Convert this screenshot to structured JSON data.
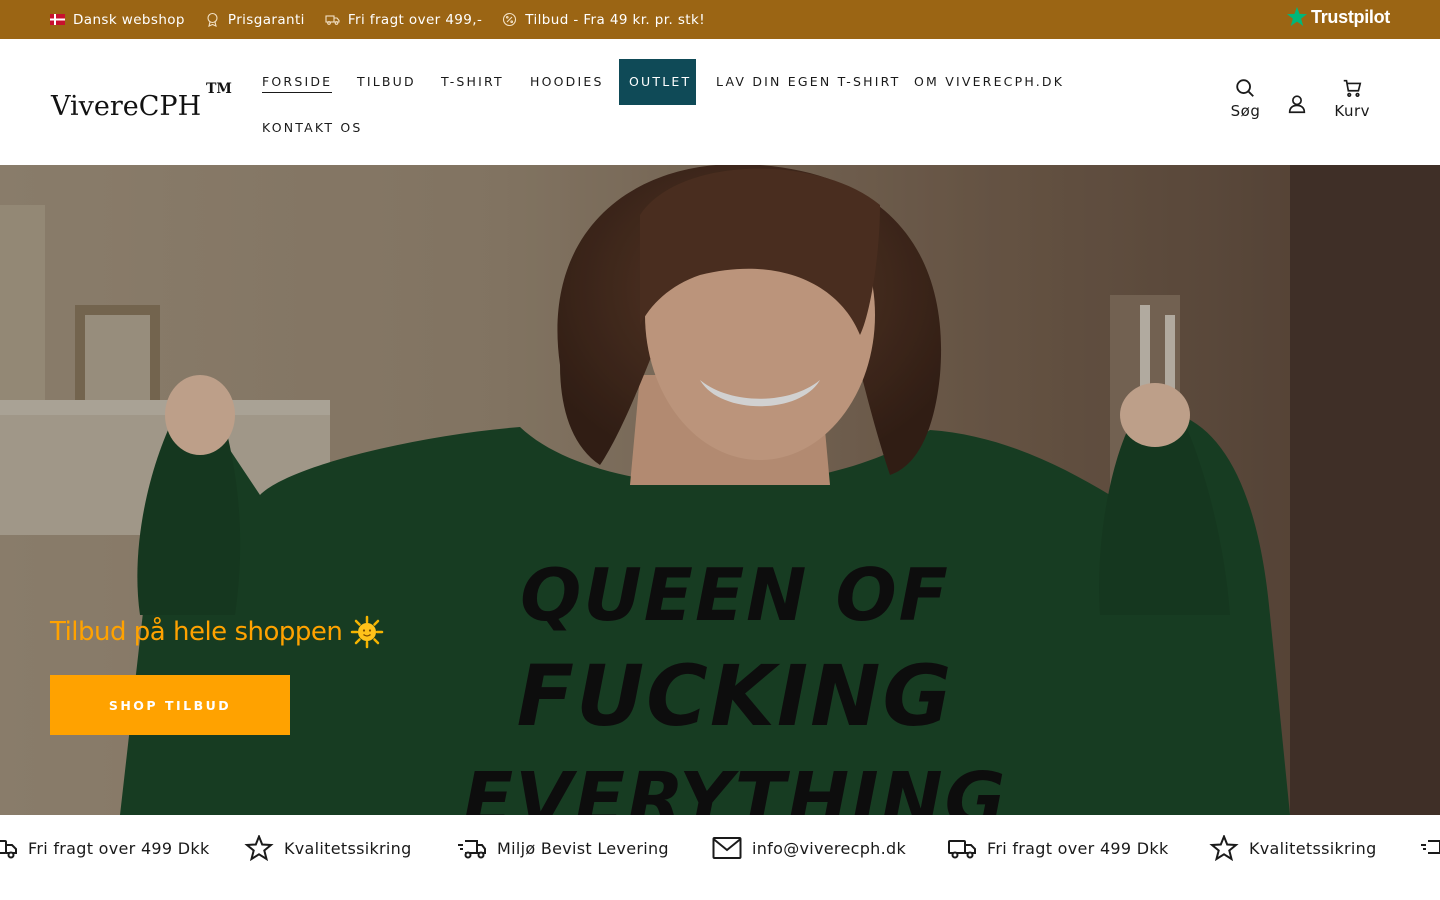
{
  "announcement": {
    "messages": [
      {
        "icon": "denmark-flag-icon",
        "text": "Dansk webshop"
      },
      {
        "icon": "award-icon",
        "text": "Prisgaranti"
      },
      {
        "icon": "truck-icon",
        "text": "Fri fragt over 499,-"
      },
      {
        "icon": "discount-icon",
        "text": "Tilbud - Fra 49 kr. pr. stk!"
      }
    ],
    "trustpilot_label": "Trustpilot",
    "background_color": "#9b6514"
  },
  "header": {
    "logo": "VivereCPH",
    "logo_mark": "TM",
    "nav": [
      {
        "label": "FORSIDE",
        "active": true
      },
      {
        "label": "TILBUD"
      },
      {
        "label": "T-SHIRT"
      },
      {
        "label": "HOODIES"
      },
      {
        "label": "OUTLET",
        "highlighted": true
      },
      {
        "label": "LAV DIN EGEN T-SHIRT"
      },
      {
        "label": "OM VIVERECPH.DK"
      },
      {
        "label": "KONTAKT OS"
      }
    ],
    "search_label": "Søg",
    "cart_label": "Kurv",
    "outlet_color": "#0f4a57"
  },
  "hero": {
    "title": "Tilbud på hele shoppen",
    "title_emoji": "sun-icon",
    "button_label": "SHOP TILBUD",
    "hoodie_print": [
      "QUEEN OF",
      "FUCKING",
      "EVERYTHING"
    ],
    "accent_color": "#ffa200"
  },
  "marquee": {
    "items": [
      {
        "icon": "truck-icon",
        "text": "Fri fragt over 499 Dkk"
      },
      {
        "icon": "star-icon",
        "text": "Kvalitetssikring"
      },
      {
        "icon": "fast-delivery-icon",
        "text": "Miljø Bevist Levering"
      },
      {
        "icon": "mail-icon",
        "text": "info@viverecph.dk"
      },
      {
        "icon": "truck-icon",
        "text": "Fri fragt over 499 Dkk"
      },
      {
        "icon": "star-icon",
        "text": "Kvalitetssikring"
      }
    ]
  }
}
